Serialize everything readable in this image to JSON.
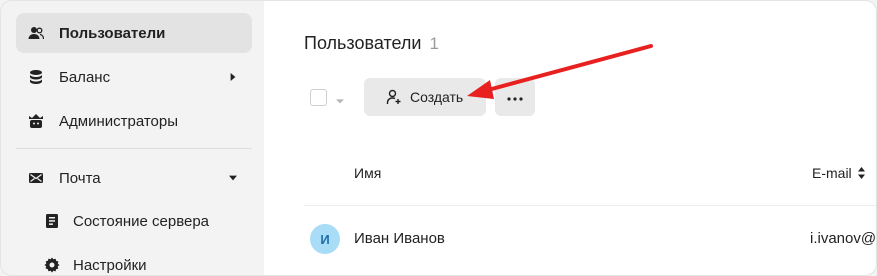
{
  "sidebar": {
    "items": [
      {
        "label": "Пользователи",
        "icon": "users-icon"
      },
      {
        "label": "Баланс",
        "icon": "database-icon"
      },
      {
        "label": "Администраторы",
        "icon": "admin-icon"
      },
      {
        "label": "Почта",
        "icon": "mail-icon"
      },
      {
        "label": "Состояние сервера",
        "icon": "server-status-icon"
      },
      {
        "label": "Настройки",
        "icon": "gear-icon"
      }
    ]
  },
  "main": {
    "title": "Пользователи",
    "count": "1",
    "create_label": "Создать",
    "table": {
      "columns": [
        "Имя",
        "E-mail"
      ],
      "rows": [
        {
          "initial": "И",
          "name": "Иван Иванов",
          "email": "i.ivanov@"
        }
      ]
    }
  },
  "colors": {
    "accent_arrow": "#e8201f",
    "avatar_bg": "#a9dcf7",
    "active_nav_bg": "#e3e3e3"
  }
}
